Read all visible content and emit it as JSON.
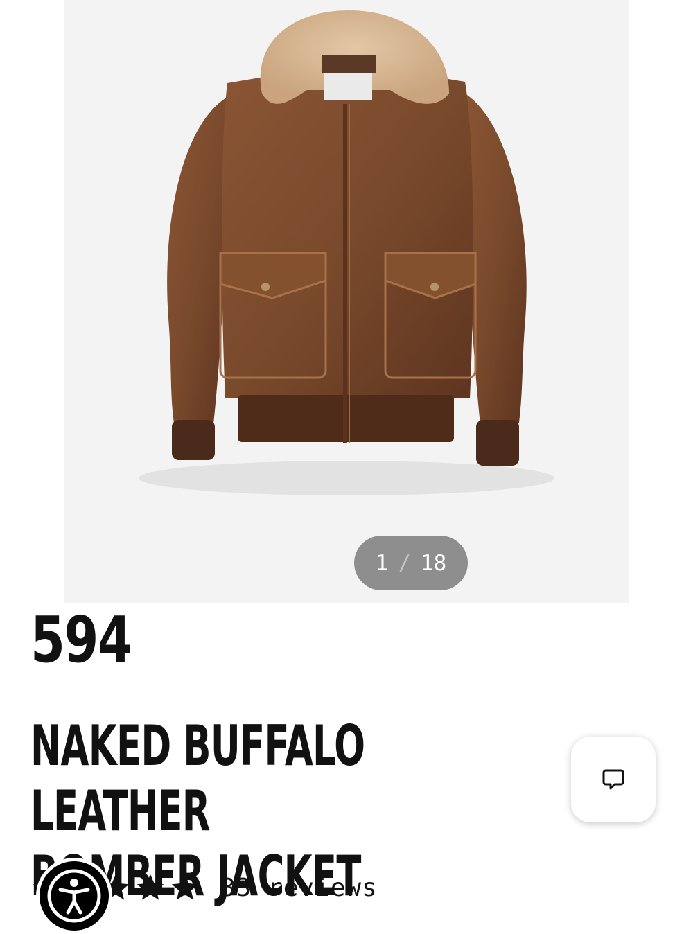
{
  "gallery": {
    "current": "1",
    "separator": "/",
    "total": "18"
  },
  "product": {
    "price": "594",
    "title_line1": "NAKED BUFFALO LEATHER",
    "title_line2": "BOMBER JACKET",
    "rating": {
      "stars": 5,
      "reviews_text": "33 reviews"
    }
  },
  "icons": {
    "chat": "chat-icon",
    "accessibility": "accessibility-icon",
    "star": "star-icon"
  },
  "colors": {
    "leather": "#7a4a2c",
    "collar": "#d9b794",
    "counter_bg": "#8e8e8e"
  }
}
